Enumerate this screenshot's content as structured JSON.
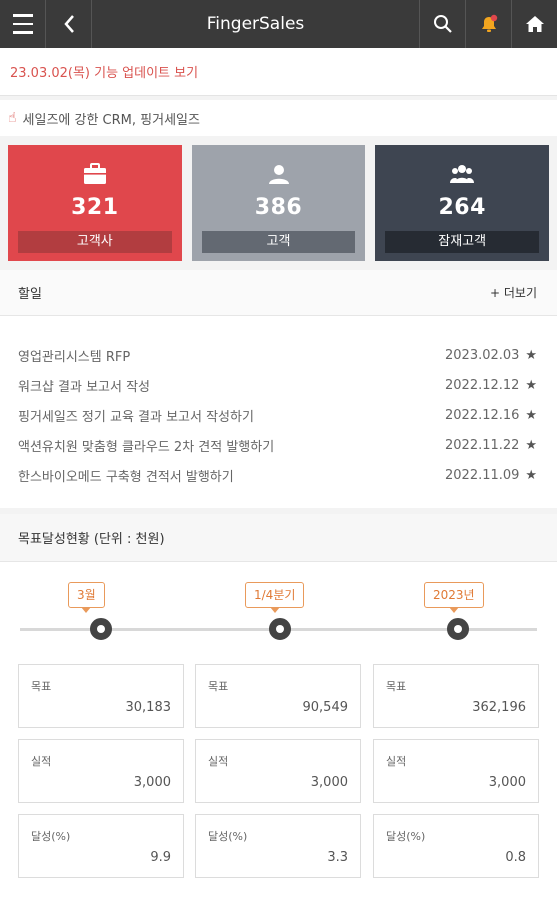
{
  "header": {
    "title": "FingerSales",
    "menu_icon": "hamburger-menu-icon",
    "back_icon": "chevron-left-icon",
    "search_icon": "search-icon",
    "bell_icon": "notification-bell-icon",
    "home_icon": "home-icon"
  },
  "notice": {
    "text": "23.03.02(목) 기능 업데이트 보기"
  },
  "slogan": {
    "icon": "pointing-hand-icon",
    "text": "세일즈에 강한 CRM, 핑거세일즈"
  },
  "cards": [
    {
      "icon": "briefcase-icon",
      "count": "321",
      "label": "고객사",
      "color": "#e0474c"
    },
    {
      "icon": "person-icon",
      "count": "386",
      "label": "고객",
      "color": "#9ea3ab"
    },
    {
      "icon": "group-icon",
      "count": "264",
      "label": "잠재고객",
      "color": "#3e4551"
    }
  ],
  "todo": {
    "title": "할일",
    "more_label": "+ 더보기",
    "items": [
      {
        "text": "영업관리시스템 RFP",
        "date": "2023.02.03"
      },
      {
        "text": "워크샵 결과 보고서 작성",
        "date": "2022.12.12"
      },
      {
        "text": "핑거세일즈 정기 교육 결과 보고서 작성하기",
        "date": "2022.12.16"
      },
      {
        "text": "액션유치원 맞춤형 클라우드 2차 견적 발행하기",
        "date": "2022.11.22"
      },
      {
        "text": "한스바이오메드 구축형 견적서 발행하기",
        "date": "2022.11.09"
      }
    ]
  },
  "goal": {
    "title": "목표달성현황 (단위 : 천원)",
    "periods": [
      "3월",
      "1/4분기",
      "2023년"
    ],
    "metrics": [
      {
        "label": "목표",
        "values": [
          "30,183",
          "90,549",
          "362,196"
        ]
      },
      {
        "label": "실적",
        "values": [
          "3,000",
          "3,000",
          "3,000"
        ]
      },
      {
        "label": "달성(%)",
        "values": [
          "9.9",
          "3.3",
          "0.8"
        ]
      }
    ]
  }
}
